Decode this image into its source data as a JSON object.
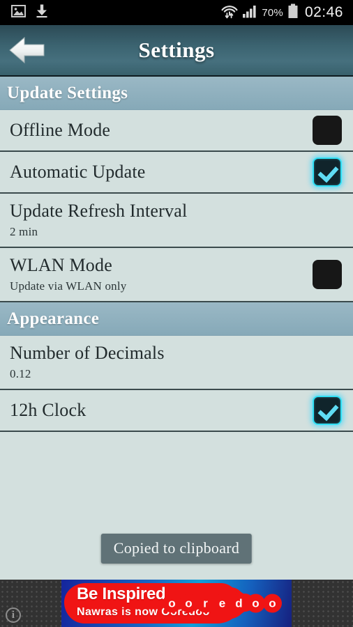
{
  "status_bar": {
    "left_icons": [
      "image-icon",
      "download-icon"
    ],
    "wifi_icon": "wifi-transfer-icon",
    "signal_icon": "cellular-signal-icon",
    "battery_percent": "70%",
    "battery_icon": "battery-icon",
    "clock": "02:46"
  },
  "header": {
    "back_icon": "back-arrow-icon",
    "title": "Settings"
  },
  "sections": [
    {
      "title": "Update Settings",
      "rows": [
        {
          "title": "Offline Mode",
          "subtitle": "",
          "control": "checkbox",
          "checked": false
        },
        {
          "title": "Automatic Update",
          "subtitle": "",
          "control": "checkbox",
          "checked": true
        },
        {
          "title": "Update Refresh Interval",
          "subtitle": "2 min",
          "control": "none",
          "checked": false
        },
        {
          "title": "WLAN Mode",
          "subtitle": "Update via WLAN only",
          "control": "checkbox",
          "checked": false
        }
      ]
    },
    {
      "title": "Appearance",
      "rows": [
        {
          "title": "Number of Decimals",
          "subtitle": "0.12",
          "control": "none",
          "checked": false
        },
        {
          "title": "12h Clock",
          "subtitle": "",
          "control": "checkbox",
          "checked": true
        }
      ]
    }
  ],
  "toast": {
    "message": "Copied to clipboard"
  },
  "ad": {
    "headline": "Be Inspired",
    "subline": "Nawras is now Ooredoo",
    "brand": "ooredoo",
    "info_icon": "info-icon",
    "info_label": "i"
  },
  "colors": {
    "accent_cyan": "#5fdcf4",
    "list_background": "#d3e0de",
    "section_header": "#8fb0be",
    "title_bar": "#3b6370",
    "ad_red": "#f01414",
    "ad_blue": "#1766c4"
  }
}
